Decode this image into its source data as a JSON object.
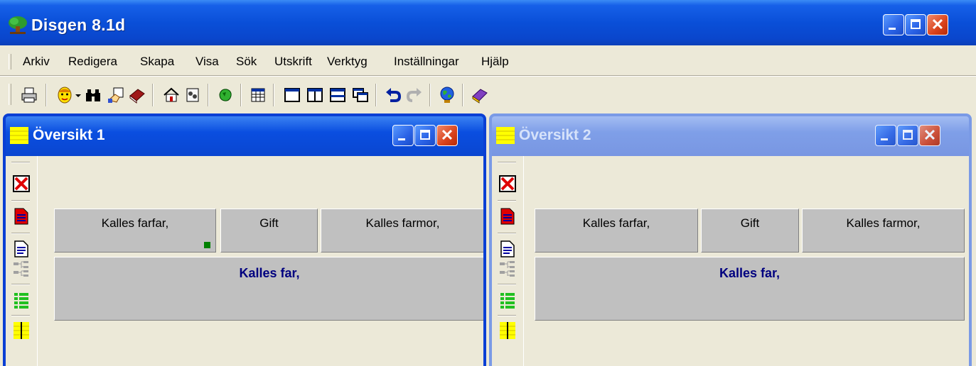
{
  "app": {
    "title": "Disgen 8.1d"
  },
  "menu": [
    {
      "label": "Arkiv"
    },
    {
      "label": "Redigera"
    },
    {
      "label": "Skapa"
    },
    {
      "label": "Visa"
    },
    {
      "label": "Sök"
    },
    {
      "label": "Utskrift"
    },
    {
      "label": "Verktyg"
    },
    {
      "label": "Inställningar"
    },
    {
      "label": "Hjälp"
    }
  ],
  "toolbar": [
    "printer-icon",
    "person-icon",
    "dropdown-arrow-icon",
    "binoculars-icon",
    "hand-note-icon",
    "book-icon",
    "home-icon",
    "notebook-icon",
    "globe-green-icon",
    "grid-icon",
    "single-pane-icon",
    "two-columns-icon",
    "two-rows-icon",
    "cascade-windows-icon",
    "undo-icon",
    "redo-icon",
    "world-icon",
    "help-book-icon"
  ],
  "windows": [
    {
      "title": "Översikt 1",
      "active": true,
      "father_of_father": "Kalles farfar,",
      "relation": "Gift",
      "mother_of_father": "Kalles farmor,",
      "person": "Kalles far,"
    },
    {
      "title": "Översikt 2",
      "active": false,
      "father_of_father": "Kalles farfar,",
      "relation": "Gift",
      "mother_of_father": "Kalles farmor,",
      "person": "Kalles far,"
    }
  ],
  "colors": {
    "title_blue": "#0a4fd8",
    "person_text": "#00007f",
    "marker_green": "#008000"
  }
}
